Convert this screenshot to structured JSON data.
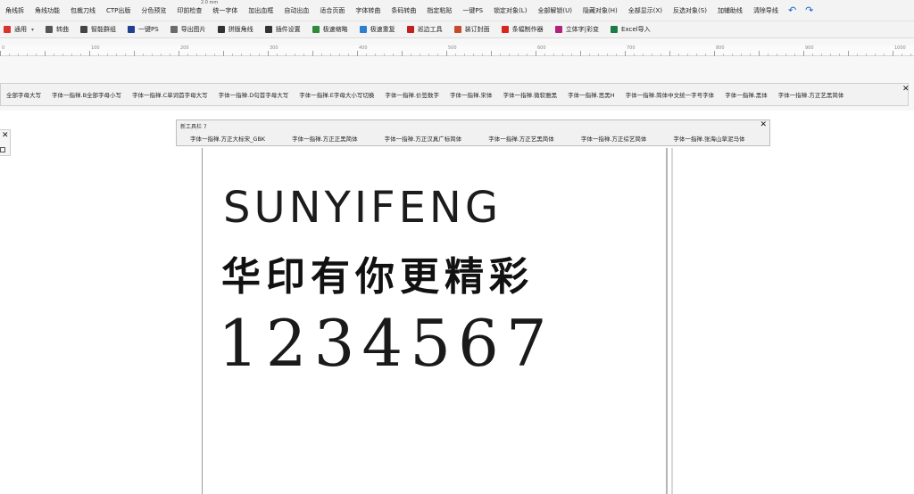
{
  "menu": {
    "items": [
      "角线拆",
      "角线功能",
      "包裁刀线",
      "CTP出版",
      "分色预览",
      "印前检查",
      "统一字体",
      "加出血框",
      "自动出血",
      "适合页面",
      "字体转曲",
      "条码转曲",
      "指定粘贴",
      "一键PS",
      "锁定对象(L)",
      "全部解锁(U)",
      "隐藏对象(H)",
      "全部显示(X)",
      "反选对象(S)",
      "加辅助线",
      "清除导线"
    ],
    "undo_glyph": "↶",
    "redo_glyph": "↷",
    "unit_readout": "2.0 mm"
  },
  "toolbar": {
    "items": [
      {
        "label": "通用",
        "icon": "red-arrow-icon",
        "color": "#d9342b",
        "caret": "▾"
      },
      {
        "label": "转曲",
        "icon": "refresh-icon",
        "color": "#555555"
      },
      {
        "label": "智能群组",
        "icon": "group-icon",
        "color": "#444444"
      },
      {
        "label": "一键PS",
        "icon": "ps-icon",
        "color": "#1f3f8f"
      },
      {
        "label": "导出图片",
        "icon": "image-export-icon",
        "color": "#6a6a6a"
      },
      {
        "label": "拼版角线",
        "icon": "corner-mark-icon",
        "color": "#333333"
      },
      {
        "label": "插件设置",
        "icon": "gear-icon",
        "color": "#333333"
      },
      {
        "label": "极速缩略",
        "icon": "rotate-icon",
        "color": "#2f8a3a"
      },
      {
        "label": "极速重复",
        "icon": "repeat-icon",
        "color": "#2a7fd0"
      },
      {
        "label": "巡边工具",
        "icon": "edge-tool-icon",
        "color": "#c0201f"
      },
      {
        "label": "装订封面",
        "icon": "book-cover-icon",
        "color": "#c64b2a"
      },
      {
        "label": "条幅制作器",
        "icon": "banner-icon",
        "color": "#d8261f"
      },
      {
        "label": "立体字|彩变",
        "icon": "3d-text-icon",
        "color": "#b3227a"
      },
      {
        "label": "Excel导入",
        "icon": "excel-icon",
        "color": "#1e7b45"
      }
    ]
  },
  "ruler": {
    "labels": [
      "0",
      "100",
      "200",
      "300",
      "400",
      "500",
      "600",
      "700",
      "800",
      "900",
      "1000"
    ]
  },
  "font_toolbar": {
    "items": [
      "全部字母大写",
      "字体一指禅.B全部字母小写",
      "字体一指禅.C单词首字母大写",
      "字体一指禅.D句首字母大写",
      "字体一指禅.E字母大小写切换",
      "字体一指禅.价签数字",
      "字体一指禅.宋体",
      "字体一指禅.微软雅黑",
      "字体一指禅.思黑H",
      "字体一指禅.简体中文统一字号字体",
      "字体一指禅.黑体",
      "字体一指禅.方正艺黑简体"
    ],
    "close": "✕"
  },
  "side_panel": {
    "close": "✕"
  },
  "new_toolbar": {
    "title": "新工具栏 7",
    "close": "✕",
    "items": [
      "字体一指禅.方正大标宋_GBK",
      "字体一指禅.方正正黑简体",
      "字体一指禅.方正汉真广标简体",
      "字体一指禅.方正艺黑简体",
      "字体一指禅.方正综艺简体",
      "字体一指禅.张海山草泥马体"
    ]
  },
  "canvas": {
    "line_english": "SUNYIFENG",
    "line_chinese": "华印有你更精彩",
    "line_numbers": "1234567"
  }
}
